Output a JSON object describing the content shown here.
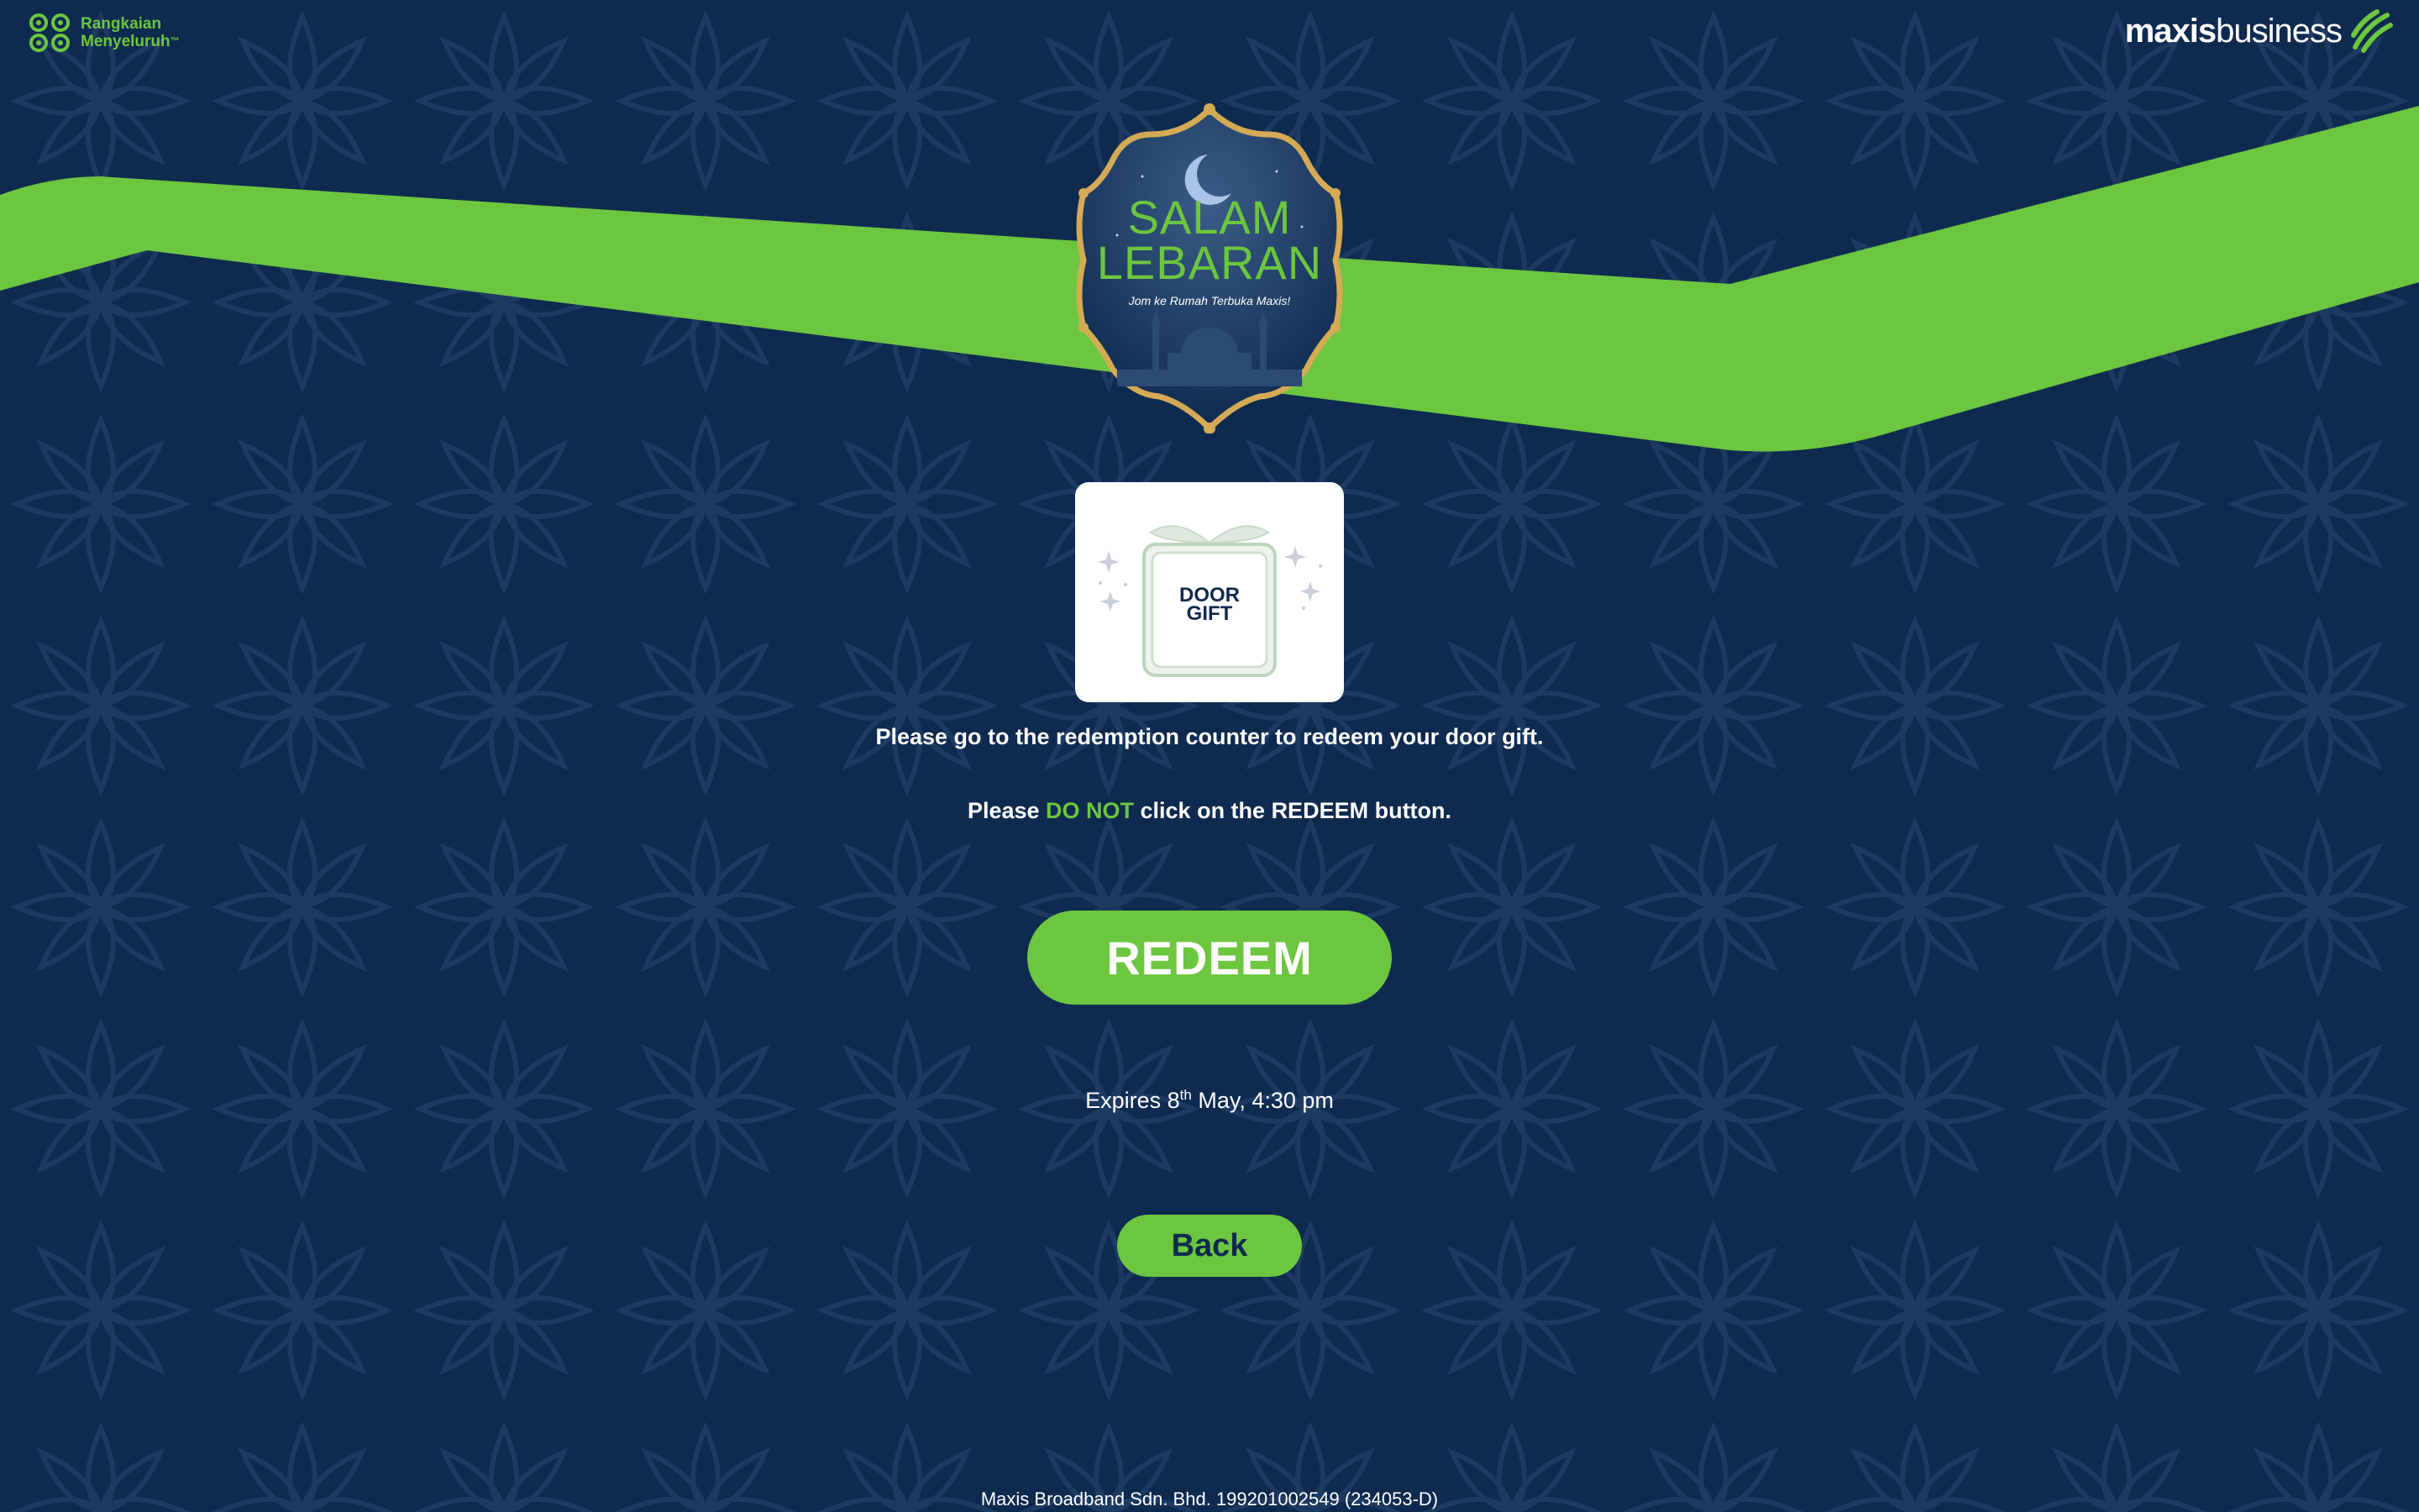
{
  "header": {
    "left_logo_line1": "Rangkaian",
    "left_logo_line2": "Menyeluruh",
    "left_logo_tm": "™",
    "right_logo_bold": "maxis",
    "right_logo_regular": "business"
  },
  "badge": {
    "title_line1": "SALAM",
    "title_line2": "LEBARAN",
    "subtitle": "Jom ke Rumah Terbuka Maxis!"
  },
  "gift": {
    "label_line1": "DOOR",
    "label_line2": "GIFT"
  },
  "messages": {
    "instruction": "Please go to the redemption counter to redeem your door gift.",
    "warning_prefix": "Please ",
    "warning_emphasis": "DO NOT",
    "warning_middle": " click on the ",
    "warning_button_name": "REDEEM",
    "warning_suffix": " button."
  },
  "redeem_button": {
    "label": "REDEEM"
  },
  "expiry": {
    "prefix": "Expires 8",
    "superscript": "th",
    "suffix": " May, 4:30 pm"
  },
  "back_button": {
    "label": "Back"
  },
  "footer": {
    "text": "Maxis Broadband Sdn. Bhd. 199201002549 (234053-D)"
  },
  "colors": {
    "background": "#0f2a4f",
    "accent_green": "#6cc63f",
    "text_white": "#ffffff",
    "gold": "#d4aa54"
  },
  "icons": {
    "left_logo": "rangkaian-menyeluruh-logo-icon",
    "right_logo": "maxis-wave-icon",
    "badge": "mosque-moon-badge-icon",
    "gift": "gift-box-icon"
  }
}
